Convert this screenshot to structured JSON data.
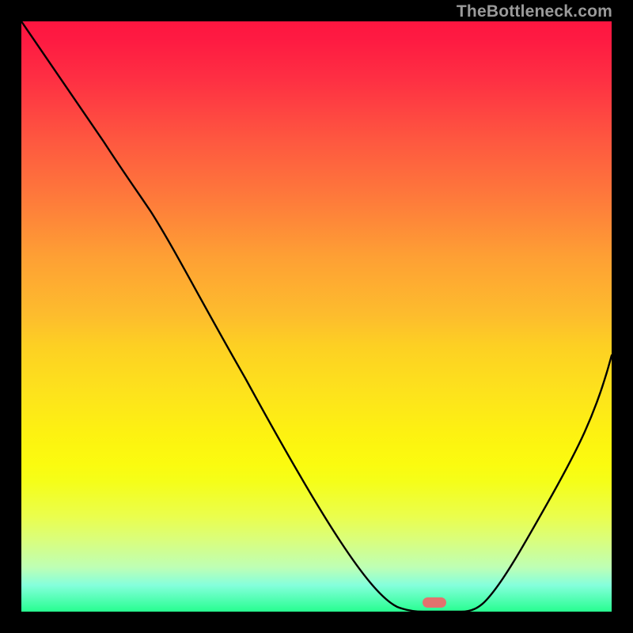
{
  "watermark": "TheBottleneck.com",
  "colors": {
    "page_bg": "#000000",
    "curve_stroke": "#000000",
    "marker_fill": "#e2726e",
    "watermark_text": "#9a9a9a",
    "gradient_top": "#fe1640",
    "gradient_bottom": "#27fe90"
  },
  "chart_data": {
    "type": "line",
    "title": "",
    "xlabel": "",
    "ylabel": "",
    "xlim": [
      0,
      100
    ],
    "ylim": [
      0,
      100
    ],
    "x": [
      0,
      14,
      22,
      30,
      38,
      46,
      54,
      62,
      66,
      70,
      74,
      78,
      82,
      86,
      90,
      94,
      100
    ],
    "values": [
      100,
      79.6,
      67.7,
      53.8,
      39.6,
      25.6,
      11.9,
      1.3,
      0.0,
      0.0,
      0.0,
      2.0,
      8.3,
      16.2,
      24.0,
      31.7,
      43.4
    ],
    "marker": {
      "x": 70,
      "y": 0.7
    },
    "legend": "off",
    "grid": "off",
    "background": "heatmap-gradient red→green (top→bottom)"
  }
}
